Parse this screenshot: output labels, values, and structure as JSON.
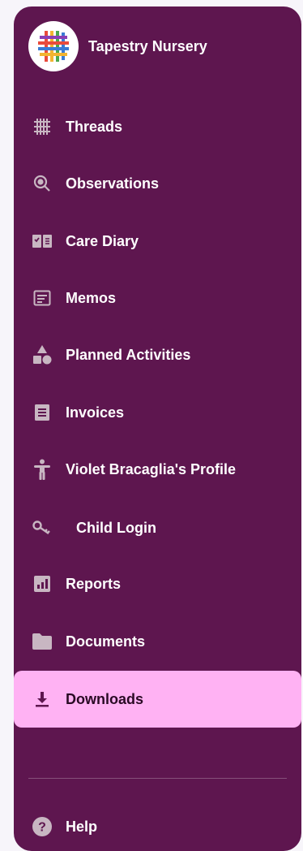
{
  "brand": {
    "name": "Tapestry Nursery"
  },
  "nav": [
    {
      "label": "Threads",
      "icon": "grid-hash-icon"
    },
    {
      "label": "Observations",
      "icon": "magnifier-eye-icon"
    },
    {
      "label": "Care Diary",
      "icon": "open-book-icon"
    },
    {
      "label": "Memos",
      "icon": "memo-icon"
    },
    {
      "label": "Planned Activities",
      "icon": "shapes-icon"
    },
    {
      "label": "Invoices",
      "icon": "document-icon"
    },
    {
      "label": "Violet Bracaglia's Profile",
      "icon": "person-icon"
    },
    {
      "label": "Child Login",
      "icon": "key-icon"
    },
    {
      "label": "Reports",
      "icon": "chart-icon"
    },
    {
      "label": "Documents",
      "icon": "folder-icon"
    },
    {
      "label": "Downloads",
      "icon": "download-icon"
    }
  ],
  "help": {
    "label": "Help",
    "icon": "help-circle-icon"
  },
  "colors": {
    "sidebar_bg": "#5e164f",
    "active_bg": "#ffb2f3",
    "icon_muted": "#c8b6c2",
    "active_icon": "#5e164f"
  }
}
